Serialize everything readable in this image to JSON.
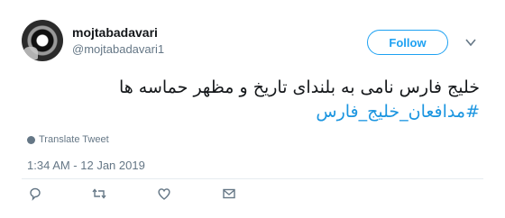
{
  "author": {
    "display_name": "mojtabadavari",
    "handle": "@mojtabadavari1",
    "avatar_icon": "camera-lens-avatar"
  },
  "follow_button": {
    "label": "Follow",
    "color": "#1da1f2"
  },
  "menu_icon": "chevron-down-icon",
  "tweet": {
    "text": "خلیج فارس نامی به بلندای تاریخ و مظهر حماسه ها",
    "hashtag": "#مدافعان_خلیج_فارس",
    "hashtag_color": "#1b95e0"
  },
  "translate": {
    "label": "Translate Tweet",
    "icon": "globe-icon"
  },
  "timestamp": "1:34 AM - 12 Jan 2019",
  "actions": [
    {
      "name": "reply",
      "icon": "reply-icon"
    },
    {
      "name": "retweet",
      "icon": "retweet-icon"
    },
    {
      "name": "like",
      "icon": "heart-icon"
    },
    {
      "name": "share-dm",
      "icon": "envelope-icon"
    }
  ]
}
